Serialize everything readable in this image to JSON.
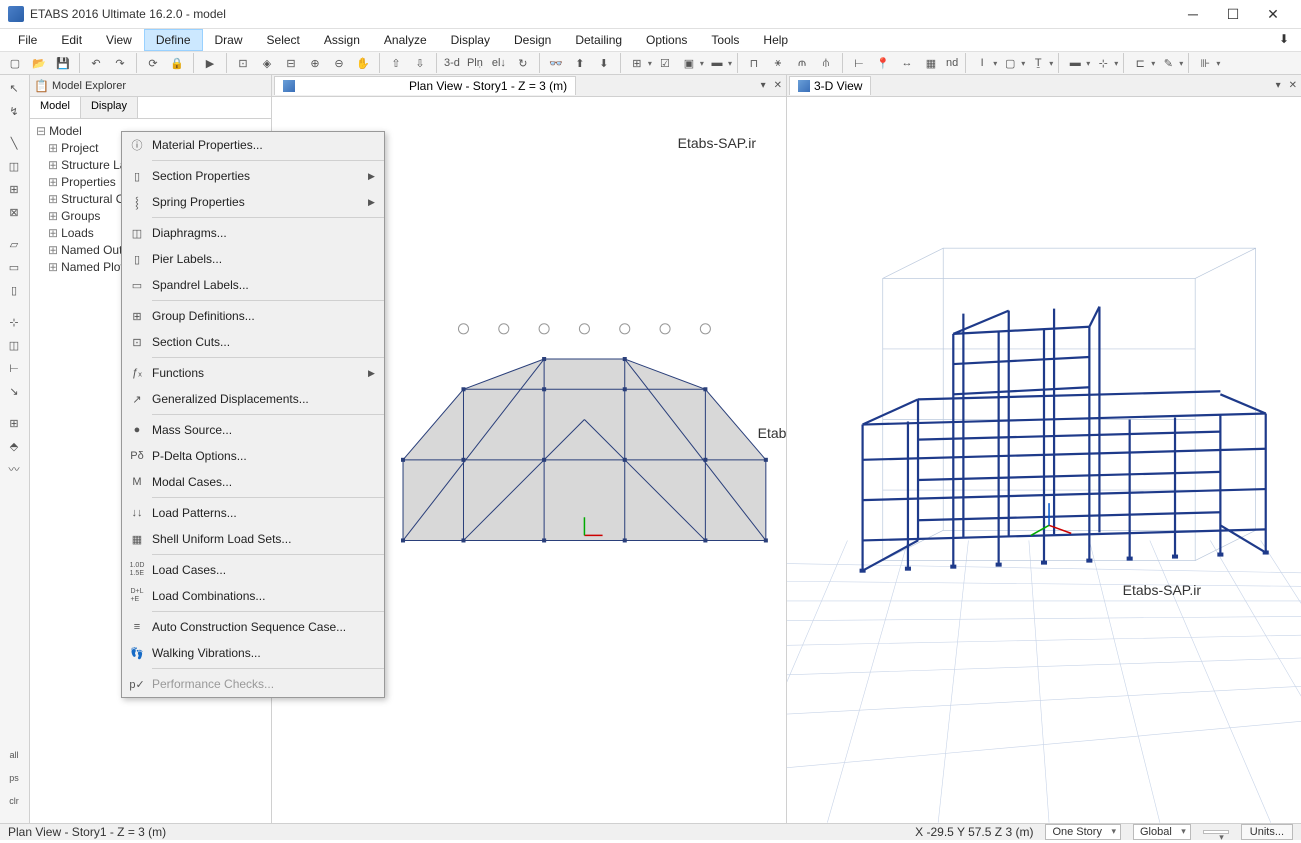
{
  "window": {
    "title": "ETABS 2016 Ultimate 16.2.0 - model"
  },
  "menubar": [
    "File",
    "Edit",
    "View",
    "Define",
    "Draw",
    "Select",
    "Assign",
    "Analyze",
    "Display",
    "Design",
    "Detailing",
    "Options",
    "Tools",
    "Help"
  ],
  "menubar_active": "Define",
  "toolbar": {
    "threed": "3-d",
    "nd": "nd"
  },
  "explorer": {
    "title": "Model Explorer",
    "subtabs": [
      "Model",
      "Display"
    ],
    "tree_root": "Model",
    "tree_children": [
      "Project",
      "Structure Layout",
      "Properties",
      "Structural Objects",
      "Groups",
      "Loads",
      "Named Output",
      "Named Plots"
    ]
  },
  "views": {
    "left_tab": "Plan View - Story1 - Z = 3 (m)",
    "right_tab": "3-D View"
  },
  "watermark": "Etabs-SAP.ir",
  "dropdown": {
    "items": [
      {
        "label": "Material Properties...",
        "icon": "ⓘ"
      },
      {
        "sep": true
      },
      {
        "label": "Section Properties",
        "icon": "▯",
        "sub": true
      },
      {
        "label": "Spring Properties",
        "icon": "⸾",
        "sub": true
      },
      {
        "sep": true
      },
      {
        "label": "Diaphragms...",
        "icon": "◫"
      },
      {
        "label": "Pier Labels...",
        "icon": "▯"
      },
      {
        "label": "Spandrel Labels...",
        "icon": "▭"
      },
      {
        "sep": true
      },
      {
        "label": "Group Definitions...",
        "icon": "⊞"
      },
      {
        "label": "Section Cuts...",
        "icon": "⊡"
      },
      {
        "sep": true
      },
      {
        "label": "Functions",
        "icon": "ƒₓ",
        "sub": true
      },
      {
        "label": "Generalized Displacements...",
        "icon": "↗"
      },
      {
        "sep": true
      },
      {
        "label": "Mass Source...",
        "icon": "●"
      },
      {
        "label": "P-Delta Options...",
        "icon": "Pδ"
      },
      {
        "label": "Modal Cases...",
        "icon": "M"
      },
      {
        "sep": true
      },
      {
        "label": "Load Patterns...",
        "icon": "↓↓"
      },
      {
        "label": "Shell Uniform Load Sets...",
        "icon": "▦"
      },
      {
        "sep": true
      },
      {
        "label": "Load Cases...",
        "icon": "1.0D\n1.5E"
      },
      {
        "label": "Load Combinations...",
        "icon": "D+L\n+E"
      },
      {
        "sep": true
      },
      {
        "label": "Auto Construction Sequence Case...",
        "icon": "≡"
      },
      {
        "label": "Walking Vibrations...",
        "icon": "👣"
      },
      {
        "sep": true
      },
      {
        "label": "Performance Checks...",
        "icon": "p✓",
        "disabled": true
      }
    ]
  },
  "status": {
    "left": "Plan View - Story1 - Z = 3 (m)",
    "coords": "X -29.5  Y 57.5  Z 3 (m)",
    "story": "One Story",
    "coord_sys": "Global",
    "units": "Units..."
  }
}
